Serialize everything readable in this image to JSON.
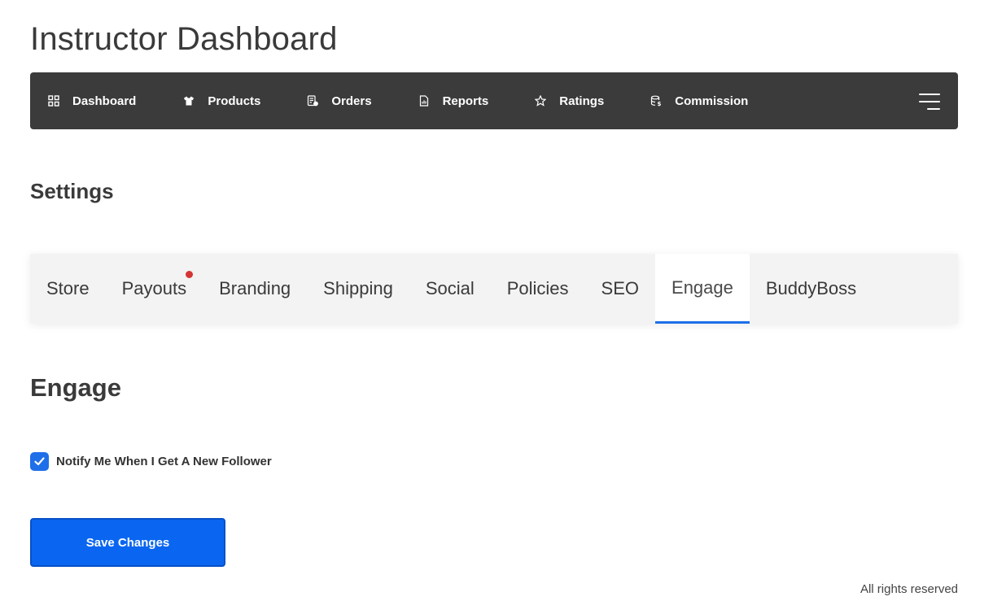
{
  "page": {
    "title": "Instructor Dashboard"
  },
  "nav": {
    "items": [
      {
        "label": "Dashboard",
        "icon": "grid-icon"
      },
      {
        "label": "Products",
        "icon": "shirt-icon"
      },
      {
        "label": "Orders",
        "icon": "orders-icon"
      },
      {
        "label": "Reports",
        "icon": "report-icon"
      },
      {
        "label": "Ratings",
        "icon": "star-icon"
      },
      {
        "label": "Commission",
        "icon": "database-money-icon"
      }
    ],
    "menu_icon": "hamburger-icon"
  },
  "settings": {
    "title": "Settings"
  },
  "tabs": {
    "items": [
      {
        "label": "Store"
      },
      {
        "label": "Payouts",
        "notification_dot": true
      },
      {
        "label": "Branding"
      },
      {
        "label": "Shipping"
      },
      {
        "label": "Social"
      },
      {
        "label": "Policies"
      },
      {
        "label": "SEO"
      },
      {
        "label": "Engage",
        "active": true
      },
      {
        "label": "BuddyBoss"
      }
    ]
  },
  "engage": {
    "title": "Engage",
    "notify_checkbox": {
      "label": "Notify Me When I Get A New Follower",
      "checked": true
    }
  },
  "actions": {
    "save_label": "Save Changes"
  },
  "footer": {
    "text": "All rights reserved"
  },
  "colors": {
    "accent": "#1f6fe8",
    "nav_bg": "#3b3b3b",
    "notification": "#d33535",
    "button": "#0a66f0"
  }
}
